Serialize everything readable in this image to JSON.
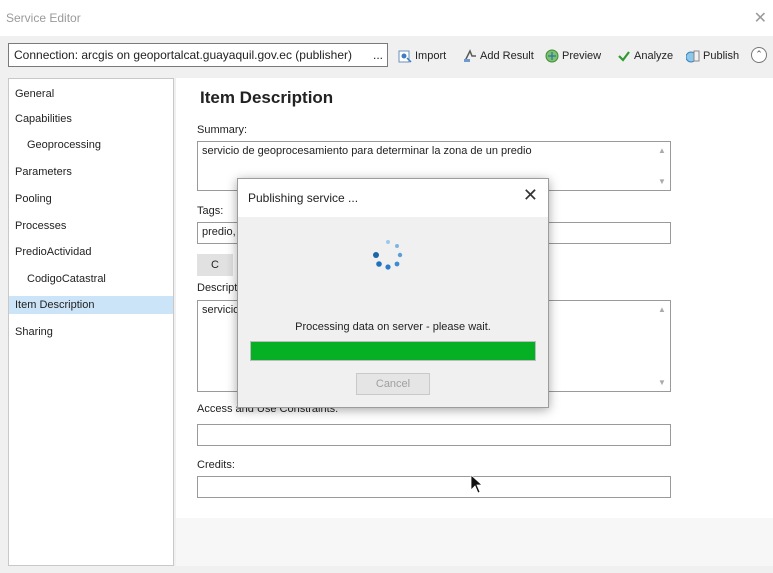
{
  "window": {
    "title": "Service Editor",
    "close_glyph": "✕"
  },
  "toolbar": {
    "connection": "Connection: arcgis on geoportalcat.guayaquil.gov.ec (publisher)",
    "connection_more": "...",
    "import_label": "Import",
    "add_result_label": "Add Result",
    "preview_label": "Preview",
    "analyze_label": "Analyze",
    "publish_label": "Publish",
    "collapse_glyph": "⌃"
  },
  "sidebar": {
    "items": [
      {
        "label": "General"
      },
      {
        "label": "Capabilities"
      },
      {
        "label": "Geoprocessing"
      },
      {
        "label": "Parameters"
      },
      {
        "label": "Pooling"
      },
      {
        "label": "Processes"
      },
      {
        "label": "PredioActividad"
      },
      {
        "label": "CodigoCatastral"
      },
      {
        "label": "Item Description"
      },
      {
        "label": "Sharing"
      }
    ],
    "selected": "Item Description"
  },
  "main": {
    "heading": "Item Description",
    "summary_label": "Summary:",
    "summary_value": "servicio de geoprocesamiento para determinar la zona de un predio",
    "tags_label": "Tags:",
    "tags_value": "predio,",
    "tags_button": "C",
    "description_label": "Descript",
    "description_value": "servicio",
    "access_label": "Access and Use Constraints:",
    "access_value": "",
    "credits_label": "Credits:",
    "credits_value": ""
  },
  "dialog": {
    "title": "Publishing service ...",
    "close_glyph": "✕",
    "message": "Processing data on server - please wait.",
    "progress": 1.0,
    "cancel_label": "Cancel"
  },
  "colors": {
    "progress_fill": "#06b025",
    "selection": "#cce4f7",
    "spinner": "#1e73be"
  }
}
